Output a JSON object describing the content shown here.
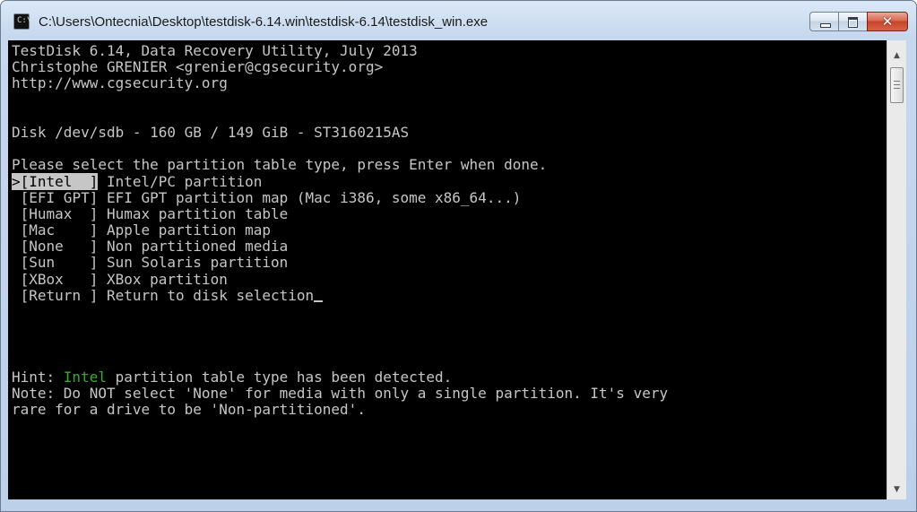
{
  "window": {
    "title": "C:\\Users\\Ontecnia\\Desktop\\testdisk-6.14.win\\testdisk-6.14\\testdisk_win.exe",
    "icon": "console-icon"
  },
  "controls": {
    "minimize_icon": "minimize-icon",
    "maximize_icon": "maximize-icon",
    "close_glyph": "✕"
  },
  "console": {
    "header": [
      "TestDisk 6.14, Data Recovery Utility, July 2013",
      "Christophe GRENIER <grenier@cgsecurity.org>",
      "http://www.cgsecurity.org"
    ],
    "disk_line": "Disk /dev/sdb - 160 GB / 149 GiB - ST3160215AS",
    "prompt": "Please select the partition table type, press Enter when done.",
    "menu": [
      {
        "pointer": ">",
        "key": "[Intel  ]",
        "desc": " Intel/PC partition"
      },
      {
        "pointer": " ",
        "key": "[EFI GPT]",
        "desc": " EFI GPT partition map (Mac i386, some x86_64...)"
      },
      {
        "pointer": " ",
        "key": "[Humax  ]",
        "desc": " Humax partition table"
      },
      {
        "pointer": " ",
        "key": "[Mac    ]",
        "desc": " Apple partition map"
      },
      {
        "pointer": " ",
        "key": "[None   ]",
        "desc": " Non partitioned media"
      },
      {
        "pointer": " ",
        "key": "[Sun    ]",
        "desc": " Sun Solaris partition"
      },
      {
        "pointer": " ",
        "key": "[XBox   ]",
        "desc": " XBox partition"
      },
      {
        "pointer": " ",
        "key": "[Return ]",
        "desc": " Return to disk selection"
      }
    ],
    "hint_prefix": "Hint: ",
    "hint_highlight": "Intel",
    "hint_suffix": " partition table type has been detected.",
    "note_line1": "Note: Do NOT select 'None' for media with only a single partition. It's very",
    "note_line2": "rare for a drive to be 'Non-partitioned'."
  },
  "colors": {
    "console_bg": "#000000",
    "console_fg": "#c6c6c6",
    "hint_green": "#2faf2f"
  }
}
